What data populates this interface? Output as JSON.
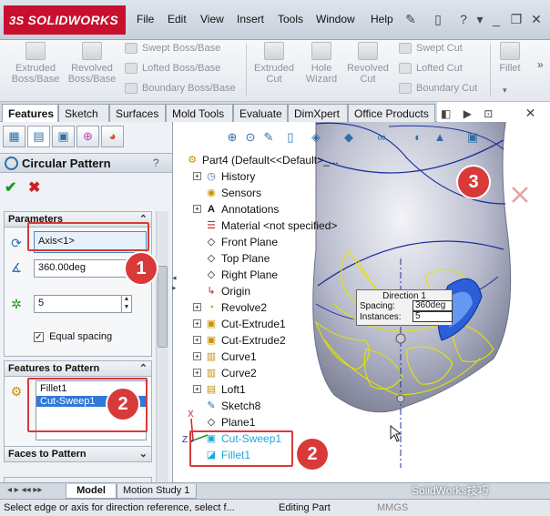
{
  "app": {
    "logo_text": "SOLIDWORKS",
    "logo_mark": "3S"
  },
  "menu": [
    "File",
    "Edit",
    "View",
    "Insert",
    "Tools",
    "Window",
    "Help"
  ],
  "ribbon": {
    "extruded_boss": "Extruded Boss/Base",
    "revolved_boss": "Revolved Boss/Base",
    "swept_boss": "Swept Boss/Base",
    "lofted_boss": "Lofted Boss/Base",
    "boundary_boss": "Boundary Boss/Base",
    "extruded_cut": "Extruded Cut",
    "hole_wizard": "Hole Wizard",
    "revolved_cut": "Revolved Cut",
    "swept_cut": "Swept Cut",
    "lofted_cut": "Lofted Cut",
    "boundary_cut": "Boundary Cut",
    "fillet": "Fillet"
  },
  "tabs": [
    "Features",
    "Sketch",
    "Surfaces",
    "Mold Tools",
    "Evaluate",
    "DimXpert",
    "Office Products"
  ],
  "property_manager": {
    "title": "Circular Pattern",
    "help": "?",
    "parameters": {
      "header": "Parameters",
      "axis": "Axis<1>",
      "angle": "360.00deg",
      "instances": "5",
      "equal_spacing": "Equal spacing",
      "equal_spacing_checked": true
    },
    "features_to_pattern": {
      "header": "Features to Pattern",
      "items": [
        "Fillet1",
        "Cut-Sweep1"
      ]
    },
    "faces_to_pattern": {
      "header": "Faces to Pattern"
    }
  },
  "tree": {
    "root": "Part4  (Default<<Default>_...",
    "items": [
      "History",
      "Sensors",
      "Annotations",
      "Material <not specified>",
      "Front Plane",
      "Top Plane",
      "Right Plane",
      "Origin",
      "Revolve2",
      "Cut-Extrude1",
      "Cut-Extrude2",
      "Curve1",
      "Curve2",
      "Loft1",
      "Sketch8",
      "Plane1",
      "Cut-Sweep1",
      "Fillet1"
    ]
  },
  "direction_tip": {
    "title": "Direction 1",
    "spacing_label": "Spacing:",
    "spacing_value": "360deg",
    "instances_label": "Instances:",
    "instances_value": "5"
  },
  "callouts": {
    "one": "1",
    "two": "2",
    "three": "3"
  },
  "triad": {
    "x": "X",
    "z": "Z"
  },
  "bottom_tabs": [
    "Model",
    "Motion Study 1"
  ],
  "status": {
    "message": "Select edge or axis for direction reference, select f...",
    "mode": "Editing Part",
    "units": "MMGS"
  },
  "watermark": "SolidWorks技巧",
  "colors": {
    "callout": "#d83a3a",
    "selection": "#20a7d8",
    "preview": "#e3e300",
    "accent": "#2f6fa7"
  }
}
